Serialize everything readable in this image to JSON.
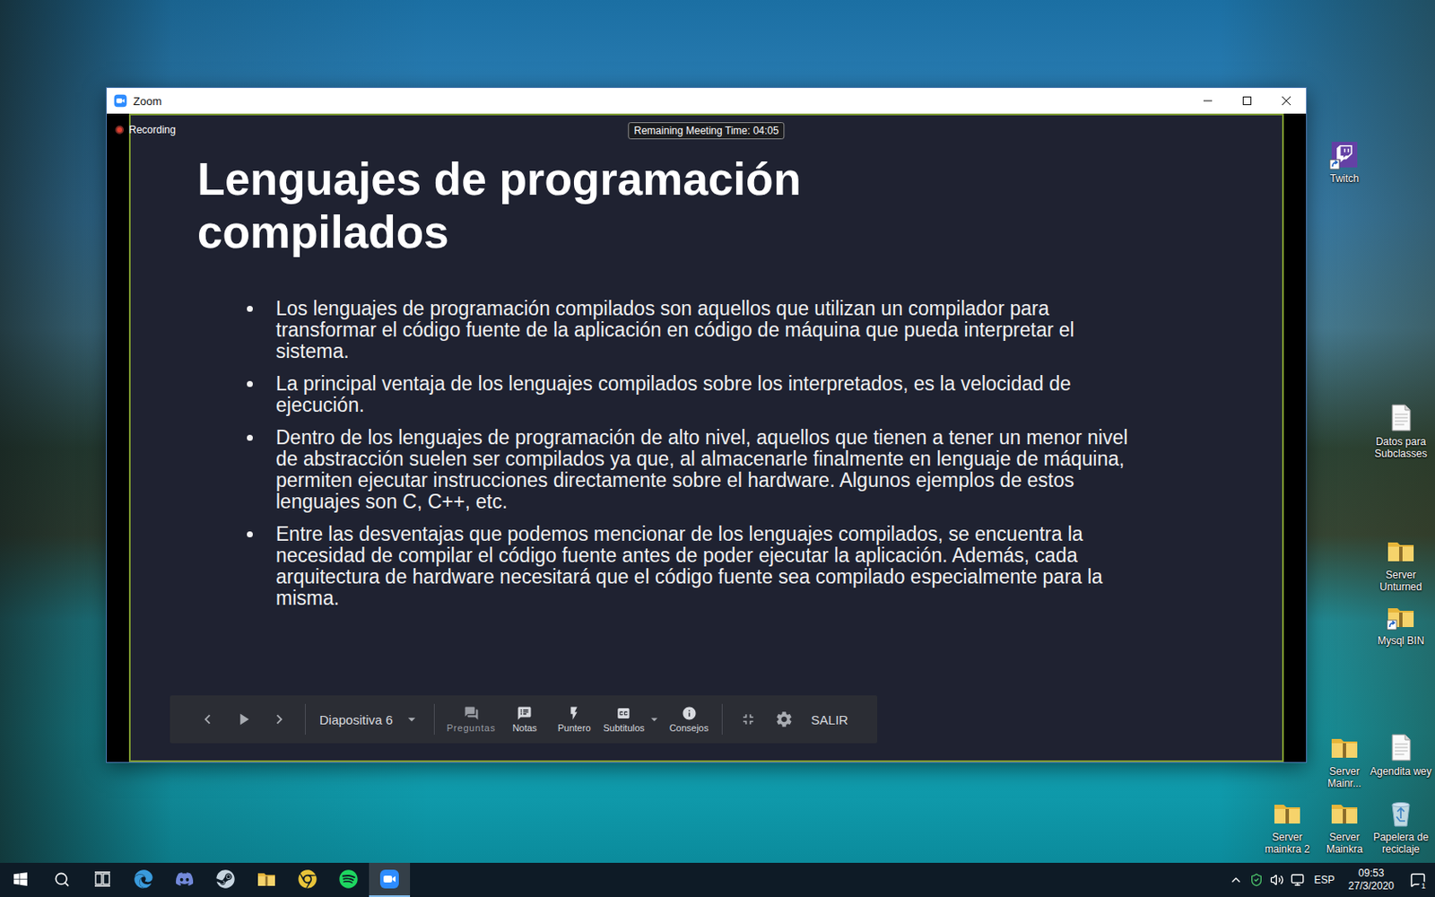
{
  "window": {
    "title": "Zoom",
    "recording": "Recording",
    "remaining_time": "Remaining Meeting Time: 04:05"
  },
  "slide": {
    "title": "Lenguajes de programación compilados",
    "bullets": [
      "Los lenguajes de programación compilados son aquellos que utilizan un compilador para transformar el código fuente de la aplicación en código de máquina que pueda interpretar el sistema.",
      "La principal ventaja de los lenguajes compilados sobre los interpretados, es la velocidad de ejecución.",
      "Dentro de los lenguajes de programación de alto nivel, aquellos que tienen a tener un menor nivel de abstracción suelen ser compilados ya que, al almacenarle finalmente en lenguaje de máquina, permiten ejecutar instrucciones directamente sobre el hardware. Algunos ejemplos de estos lenguajes son C, C++, etc.",
      "Entre las desventajas que podemos mencionar de los lenguajes compilados, se encuentra la necesidad de compilar el código fuente antes de poder ejecutar la aplicación. Además, cada arquitectura de hardware necesitará que el código fuente sea compilado especialmente para la misma."
    ]
  },
  "presenter_toolbar": {
    "slide_select": "Diapositiva 6",
    "tools": [
      {
        "label": "Preguntas",
        "kind": "questions",
        "disabled": true,
        "dropdown": false
      },
      {
        "label": "Notas",
        "kind": "notes",
        "disabled": false,
        "dropdown": false
      },
      {
        "label": "Puntero",
        "kind": "pointer",
        "disabled": false,
        "dropdown": false
      },
      {
        "label": "Subtitulos",
        "kind": "captions",
        "disabled": false,
        "dropdown": true
      },
      {
        "label": "Consejos",
        "kind": "tips",
        "disabled": false,
        "dropdown": false
      }
    ],
    "exit": "SALIR"
  },
  "desktop_icons": [
    {
      "label": "Twitch",
      "kind": "twitch"
    },
    {
      "label": "Datos para Subclasses",
      "kind": "text-file"
    },
    {
      "label": "Server Unturned",
      "kind": "folder"
    },
    {
      "label": "Mysql BIN",
      "kind": "shortcut-folder"
    },
    {
      "label": "Server Mainr...",
      "kind": "folder"
    },
    {
      "label": "Agendita wey",
      "kind": "text-file"
    },
    {
      "label": "Server mainkra 2",
      "kind": "folder"
    },
    {
      "label": "Server Mainkra",
      "kind": "folder"
    },
    {
      "label": "Papelera de reciclaje",
      "kind": "recycle-bin"
    }
  ],
  "taskbar": {
    "items": [
      {
        "kind": "start",
        "active": false
      },
      {
        "kind": "search",
        "active": false
      },
      {
        "kind": "task-view",
        "active": false
      },
      {
        "kind": "edge",
        "active": false
      },
      {
        "kind": "discord",
        "active": false
      },
      {
        "kind": "steam",
        "active": false
      },
      {
        "kind": "explorer",
        "active": false
      },
      {
        "kind": "chrome",
        "active": false
      },
      {
        "kind": "spotify",
        "active": false
      },
      {
        "kind": "zoom",
        "active": true
      }
    ],
    "tray": {
      "icons": [
        "chevron",
        "defender",
        "volume",
        "network"
      ],
      "language": "ESP",
      "time": "09:53",
      "date": "27/3/2020",
      "notifications": "1"
    }
  }
}
